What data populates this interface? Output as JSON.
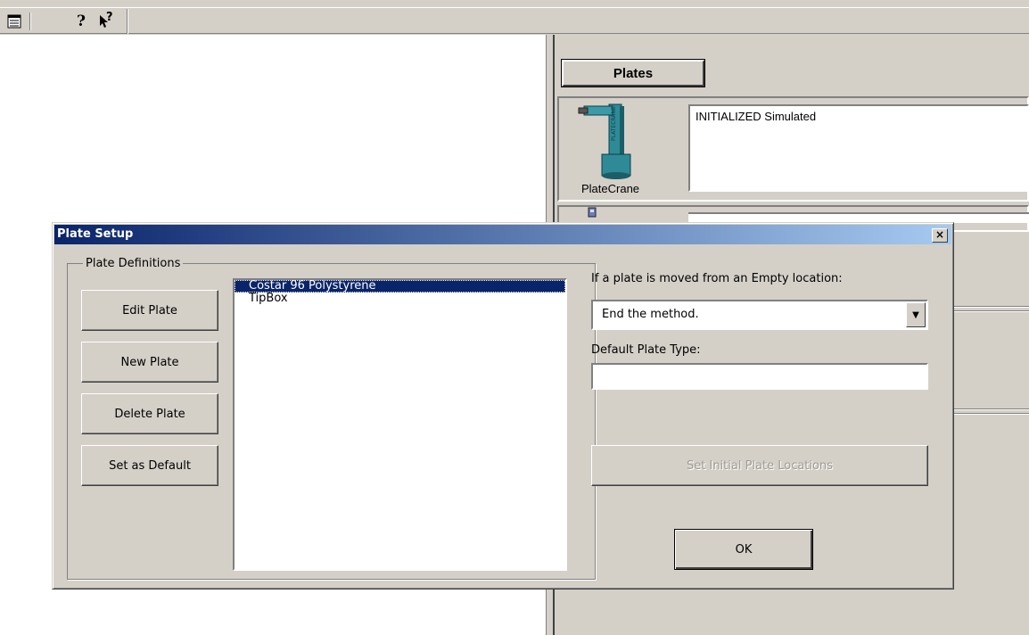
{
  "toolbar": {
    "icons": [
      "list-view-icon",
      "help-icon",
      "whats-this-icon"
    ],
    "help_glyph": "?",
    "whats_this_glyph": "?"
  },
  "panel": {
    "tab_label": "Plates",
    "devices": [
      {
        "name": "PlateCrane",
        "status": "INITIALIZED Simulated",
        "icon": "platecrane-icon"
      }
    ]
  },
  "dialog": {
    "title": "Plate Setup",
    "close_glyph": "×",
    "group_label": "Plate Definitions",
    "buttons": {
      "edit": "Edit Plate",
      "new": "New Plate",
      "delete": "Delete Plate",
      "set_default": "Set as Default"
    },
    "plate_list": [
      {
        "label": "Costar 96 Polystyrene",
        "selected": true
      },
      {
        "label": "TipBox",
        "selected": false
      }
    ],
    "empty_location_label": "If a plate is moved from an Empty location:",
    "empty_location_value": "End the method.",
    "default_type_label": "Default Plate Type:",
    "default_type_value": "",
    "set_locations_label": "Set Initial Plate Locations",
    "ok_label": "OK"
  }
}
